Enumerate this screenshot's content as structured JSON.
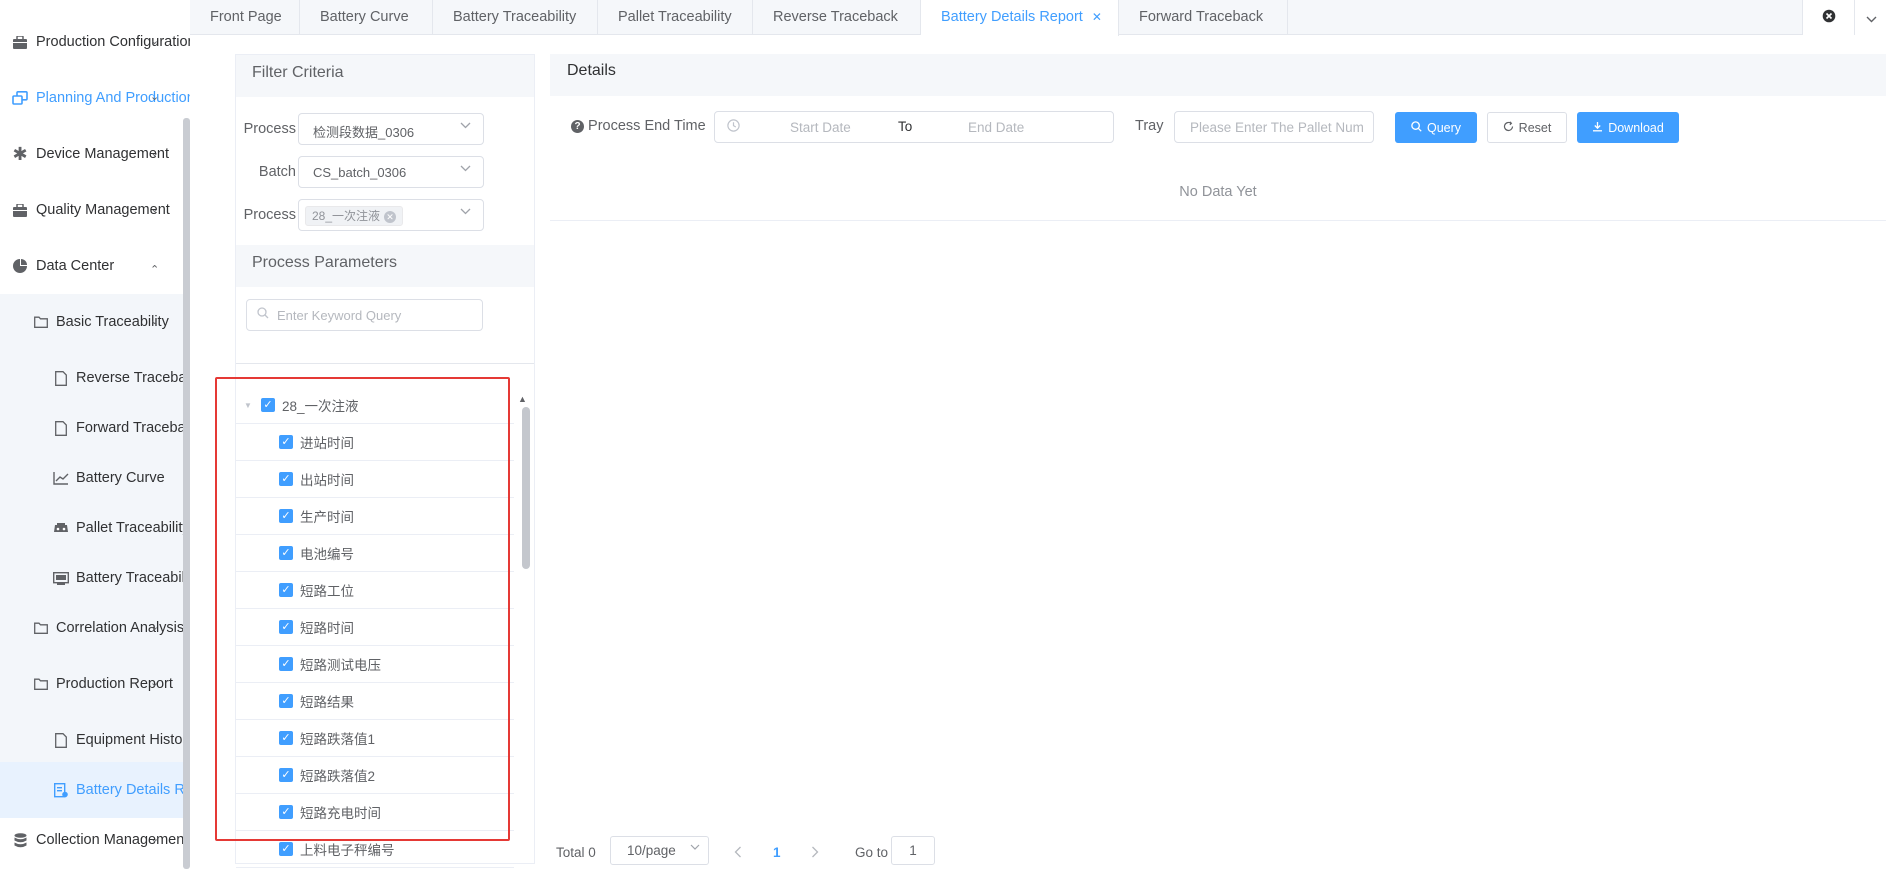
{
  "sidebar": {
    "items": [
      {
        "label": "Production Configuration",
        "icon": "briefcase-icon"
      },
      {
        "label": "Planning And Production",
        "icon": "window-stack-icon"
      },
      {
        "label": "Device Management",
        "icon": "asterisk-icon"
      },
      {
        "label": "Quality Management",
        "icon": "briefcase-icon"
      },
      {
        "label": "Data Center",
        "icon": "pie-chart-icon"
      },
      {
        "label": "Basic Traceability",
        "icon": "folder-icon"
      },
      {
        "label": "Reverse Traceback",
        "icon": "document-icon"
      },
      {
        "label": "Forward Traceback",
        "icon": "document-icon"
      },
      {
        "label": "Battery Curve",
        "icon": "line-chart-icon"
      },
      {
        "label": "Pallet Traceability",
        "icon": "pallet-icon"
      },
      {
        "label": "Battery Traceability",
        "icon": "monitor-icon"
      },
      {
        "label": "Correlation Analysis",
        "icon": "folder-icon"
      },
      {
        "label": "Production Report",
        "icon": "folder-icon"
      },
      {
        "label": "Equipment History",
        "icon": "document-icon"
      },
      {
        "label": "Battery Details Report",
        "icon": "report-icon"
      },
      {
        "label": "Collection Management",
        "icon": "database-icon"
      }
    ]
  },
  "tabs": [
    {
      "label": "Front Page"
    },
    {
      "label": "Battery Curve"
    },
    {
      "label": "Battery Traceability"
    },
    {
      "label": "Pallet Traceability"
    },
    {
      "label": "Reverse Traceback"
    },
    {
      "label": "Battery Details Report"
    },
    {
      "label": "Forward Traceback"
    }
  ],
  "filter": {
    "title": "Filter Criteria",
    "process_label": "Process",
    "process_value": "检测段数据_0306",
    "batch_label": "Batch",
    "batch_value": "CS_batch_0306",
    "process2_label": "Process",
    "process2_tag": "28_一次注液",
    "params_title": "Process Parameters",
    "keyword_placeholder": "Enter Keyword Query",
    "tree_root": "28_一次注液",
    "tree_items": [
      "进站时间",
      "出站时间",
      "生产时间",
      "电池编号",
      "短路工位",
      "短路时间",
      "短路测试电压",
      "短路结果",
      "短路跌落值1",
      "短路跌落值2",
      "短路充电时间",
      "上料电子秤编号"
    ]
  },
  "details": {
    "title": "Details",
    "end_time_label": "Process End Time",
    "start_placeholder": "Start Date",
    "to_label": "To",
    "end_placeholder": "End Date",
    "tray_label": "Tray",
    "tray_placeholder": "Please Enter The Pallet Num",
    "query_label": "Query",
    "reset_label": "Reset",
    "download_label": "Download",
    "empty_text": "No Data Yet"
  },
  "pagination": {
    "total": "Total 0",
    "page_size": "10/page",
    "current_page": "1",
    "goto_label": "Go to",
    "goto_value": "1"
  },
  "colors": {
    "accent": "#409eff",
    "highlight_box": "#e53935"
  }
}
